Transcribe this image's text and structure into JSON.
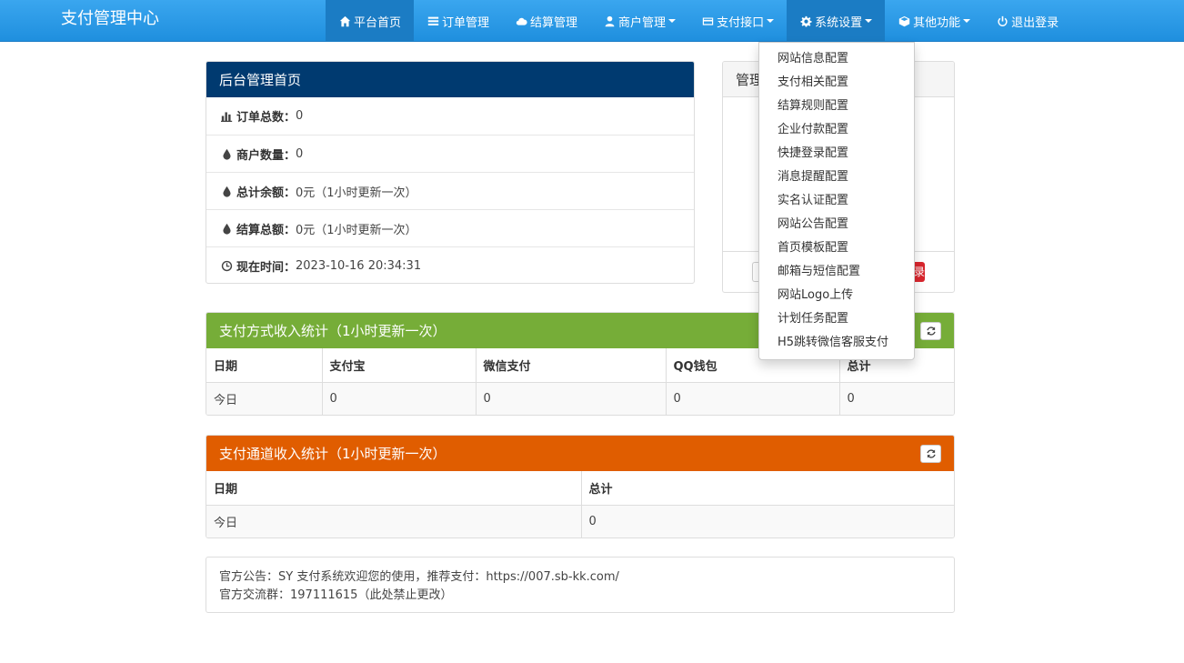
{
  "brand": "支付管理中心",
  "nav": [
    {
      "label": "平台首页",
      "icon": "home-icon",
      "active": true
    },
    {
      "label": "订单管理",
      "icon": "list-icon"
    },
    {
      "label": "结算管理",
      "icon": "cloud-icon"
    },
    {
      "label": "商户管理",
      "icon": "user-icon",
      "dropdown": true
    },
    {
      "label": "支付接口",
      "icon": "credit-card-icon",
      "dropdown": true
    },
    {
      "label": "系统设置",
      "icon": "gear-icon",
      "dropdown": true,
      "open": true
    },
    {
      "label": "其他功能",
      "icon": "cube-icon",
      "dropdown": true
    },
    {
      "label": "退出登录",
      "icon": "power-icon"
    }
  ],
  "system_menu": [
    "网站信息配置",
    "支付相关配置",
    "结算规则配置",
    "企业付款配置",
    "快捷登录配置",
    "消息提醒配置",
    "实名认证配置",
    "网站公告配置",
    "首页模板配置",
    "邮箱与短信配置",
    "网站Logo上传",
    "计划任务配置",
    "H5跳转微信客服支付"
  ],
  "home_panel": {
    "title": "后台管理首页",
    "rows": [
      {
        "label": "订单总数：",
        "value": "0",
        "icon": "bar-chart-icon"
      },
      {
        "label": "商户数量：",
        "value": "0",
        "icon": "drop-icon"
      },
      {
        "label": "总计余额：",
        "value": "0元（1小时更新一次）",
        "icon": "drop-icon"
      },
      {
        "label": "结算总额：",
        "value": "0元（1小时更新一次）",
        "icon": "drop-icon"
      },
      {
        "label": "现在时间：",
        "value": " 2023-10-16 20:34:31",
        "icon": "clock-icon"
      }
    ]
  },
  "side_panel": {
    "title": "管理",
    "button_text": "录"
  },
  "pay_type_stats": {
    "title": "支付方式收入统计（1小时更新一次）",
    "columns": [
      "日期",
      "支付宝",
      "微信支付",
      "QQ钱包",
      "总计"
    ],
    "rows": [
      [
        "今日",
        "0",
        "0",
        "0",
        "0"
      ]
    ]
  },
  "channel_stats": {
    "title": "支付通道收入统计（1小时更新一次）",
    "columns": [
      "日期",
      "总计"
    ],
    "rows": [
      [
        "今日",
        "0"
      ]
    ]
  },
  "notice": {
    "line1": "官方公告：SY 支付系统欢迎您的使用，推荐支付：https://007.sb-kk.com/",
    "line2": "官方交流群：197111615（此处禁止更改）"
  },
  "colors": {
    "navbar": "#2196e8",
    "home_heading": "#003a70",
    "pay_type_heading": "#76ad38",
    "channel_heading": "#e05d00"
  }
}
